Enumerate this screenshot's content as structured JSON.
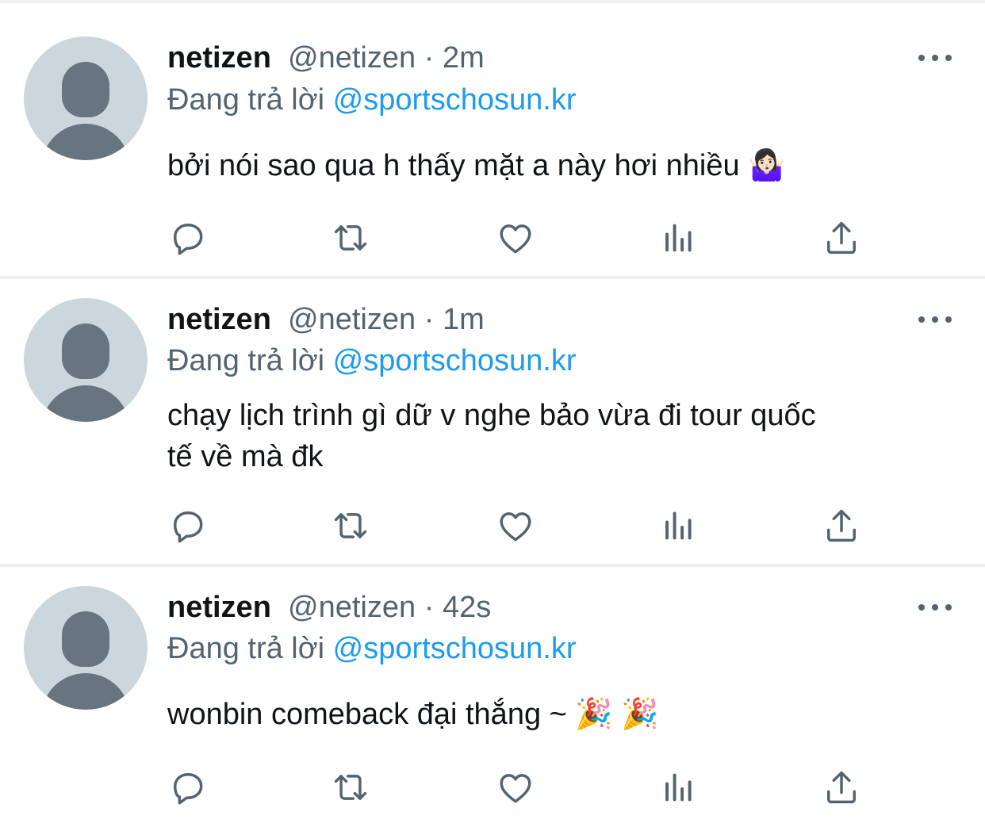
{
  "tweets": [
    {
      "name": "netizen",
      "handle": "@netizen",
      "separator": "·",
      "time": "2m",
      "reply_prefix": "Đang trả lời",
      "reply_to": "@sportschosun.kr",
      "text": "bởi nói sao qua h thấy mặt a này hơi nhiều 🤷🏻‍♀️",
      "menu_icon": "more-horizontal-icon",
      "actions": [
        "reply-icon",
        "retweet-icon",
        "like-icon",
        "analytics-icon",
        "share-icon"
      ]
    },
    {
      "name": "netizen",
      "handle": "@netizen",
      "separator": "·",
      "time": "1m",
      "reply_prefix": "Đang trả lời",
      "reply_to": "@sportschosun.kr",
      "text_line1": "chạy lịch trình gì dữ v nghe bảo vừa đi tour quốc",
      "text_line2": "tế về mà đk",
      "menu_icon": "more-horizontal-icon",
      "actions": [
        "reply-icon",
        "retweet-icon",
        "like-icon",
        "analytics-icon",
        "share-icon"
      ]
    },
    {
      "name": "netizen",
      "handle": "@netizen",
      "separator": "·",
      "time": "42s",
      "reply_prefix": "Đang trả lời",
      "reply_to": "@sportschosun.kr",
      "text": "wonbin comeback đại thắng ~ 🎉 🎉",
      "menu_icon": "more-horizontal-icon",
      "actions": [
        "reply-icon",
        "retweet-icon",
        "like-icon",
        "analytics-icon",
        "share-icon"
      ]
    }
  ],
  "colors": {
    "text_primary": "#0f1419",
    "text_secondary": "#536471",
    "link": "#1d9bf0",
    "avatar_bg": "#ccd6dd",
    "avatar_fg": "#66757f",
    "divider": "#eceef0"
  }
}
